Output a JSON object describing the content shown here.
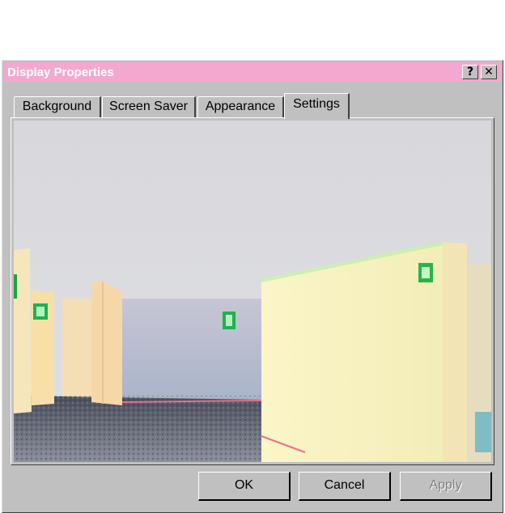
{
  "window": {
    "title": "Display Properties",
    "help_label": "?",
    "close_label": "✕",
    "titlebar_color": "#f4a8cf"
  },
  "tabs": [
    {
      "label": "Background"
    },
    {
      "label": "Screen Saver"
    },
    {
      "label": "Appearance"
    },
    {
      "label": "Settings",
      "active": true
    }
  ],
  "buttons": {
    "ok_label": "OK",
    "cancel_label": "Cancel",
    "apply_label": "Apply"
  }
}
